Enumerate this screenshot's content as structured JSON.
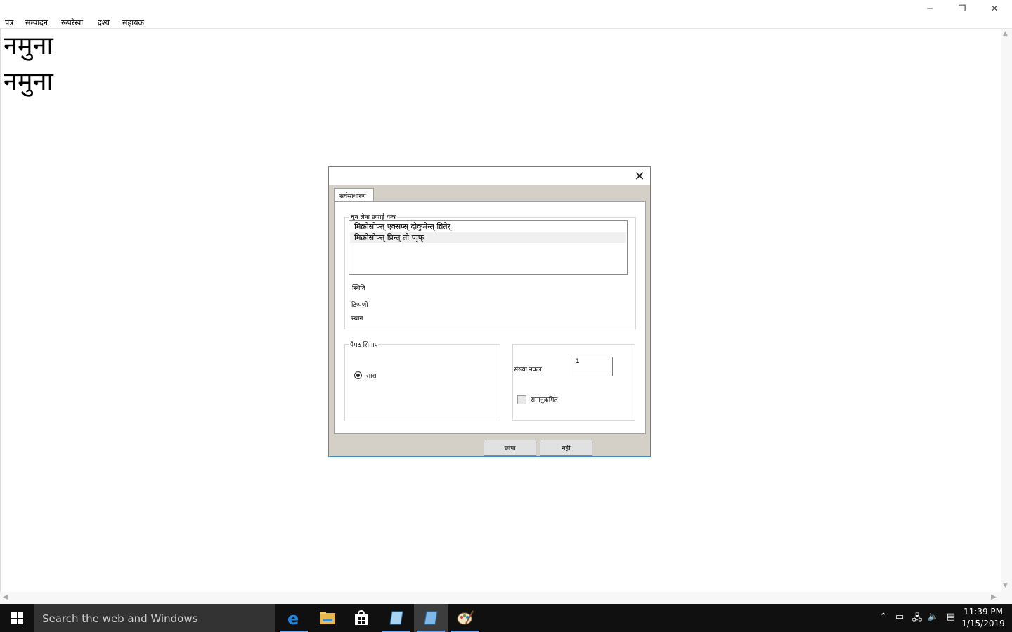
{
  "window": {
    "minimize_glyph": "─",
    "maximize_glyph": "❐",
    "close_glyph": "✕"
  },
  "menu": [
    "पत्र",
    "सम्पादन",
    "रूपरेखा",
    "द्रश्य",
    "सहायक"
  ],
  "document": {
    "lines": [
      "नमुना",
      "नमुना"
    ]
  },
  "print_dialog": {
    "close_glyph": "✕",
    "tab_label": "सर्वसाधारण",
    "printer_group_label": "चुन लेना छपाई यन्त्र",
    "printers": [
      "मिक्रोसोफ्त् एक्सप्स् दोकुमेन्त् व्रितेर्",
      "मिक्रोसोफ्त् प्रिन्त् तो प्द्फ्"
    ],
    "selected_printer_index": 1,
    "status_label": "स्थिति",
    "comment_label": "टिप्पणी",
    "location_label": "स्थान",
    "page_range_label": "पैमठ सिमाए",
    "all_pages_label": "सारा",
    "all_pages_selected": true,
    "copies_label": "संख्या नकल",
    "copies_value": "1",
    "collate_label": "समानुक्रमित",
    "collate_checked": false,
    "print_button": "छापा",
    "cancel_button": "नहीं"
  },
  "taskbar": {
    "search_placeholder": "Search the web and Windows",
    "apps": [
      "edge-icon",
      "file-explorer-icon",
      "store-icon",
      "notepad-icon",
      "editor-icon",
      "paint-icon"
    ],
    "active_app_index": 4,
    "time": "11:39 PM",
    "date": "1/15/2019",
    "accent_color": "#0078d7"
  }
}
